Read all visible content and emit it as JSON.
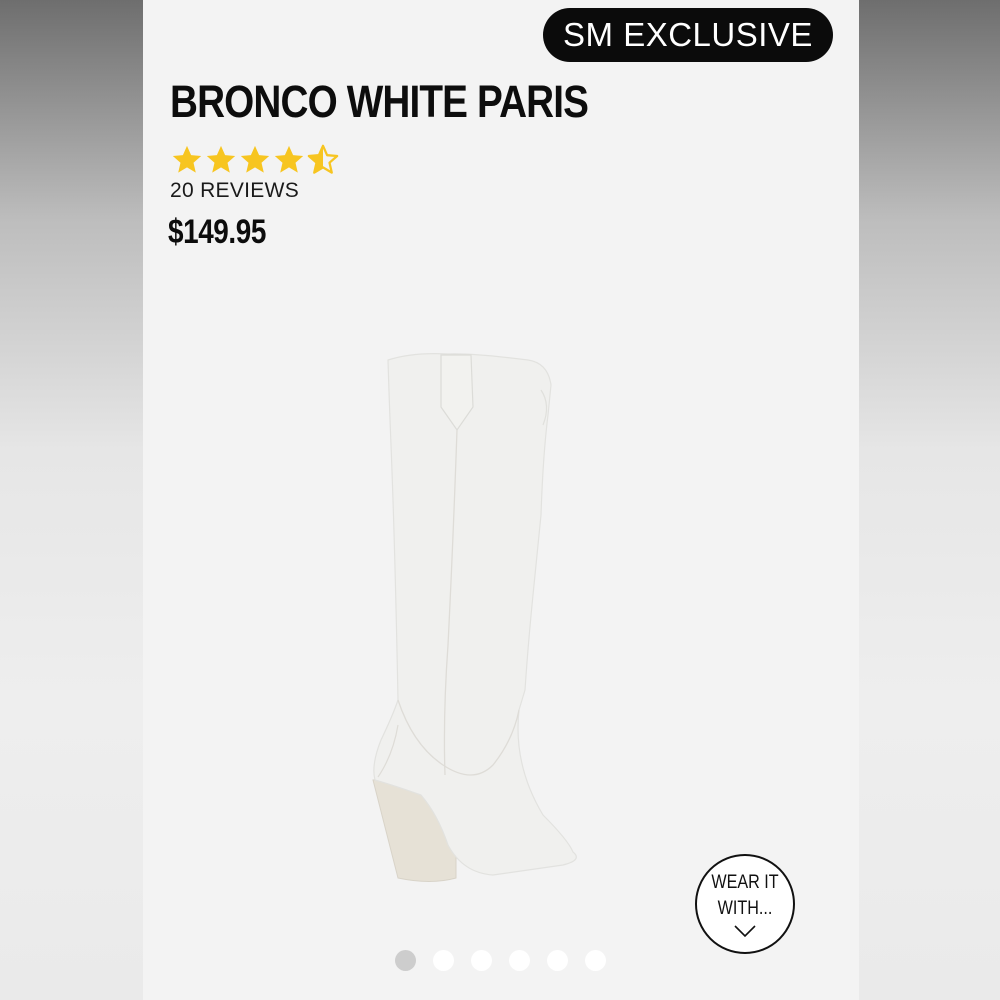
{
  "product": {
    "badge": "SM EXCLUSIVE",
    "name": "BRONCO WHITE PARIS",
    "rating": 4.5,
    "reviews_label": "20 REVIEWS",
    "price": "$149.95",
    "image_icon": "white-cowboy-boot-image"
  },
  "wear_it_with": {
    "line1": "WEAR IT",
    "line2": "WITH...",
    "icon": "chevron-down-icon"
  },
  "carousel": {
    "dot_count": 6,
    "active_index": 0
  },
  "colors": {
    "star": "#f7c520",
    "badge_bg": "#0b0b0b",
    "badge_text": "#ffffff"
  }
}
